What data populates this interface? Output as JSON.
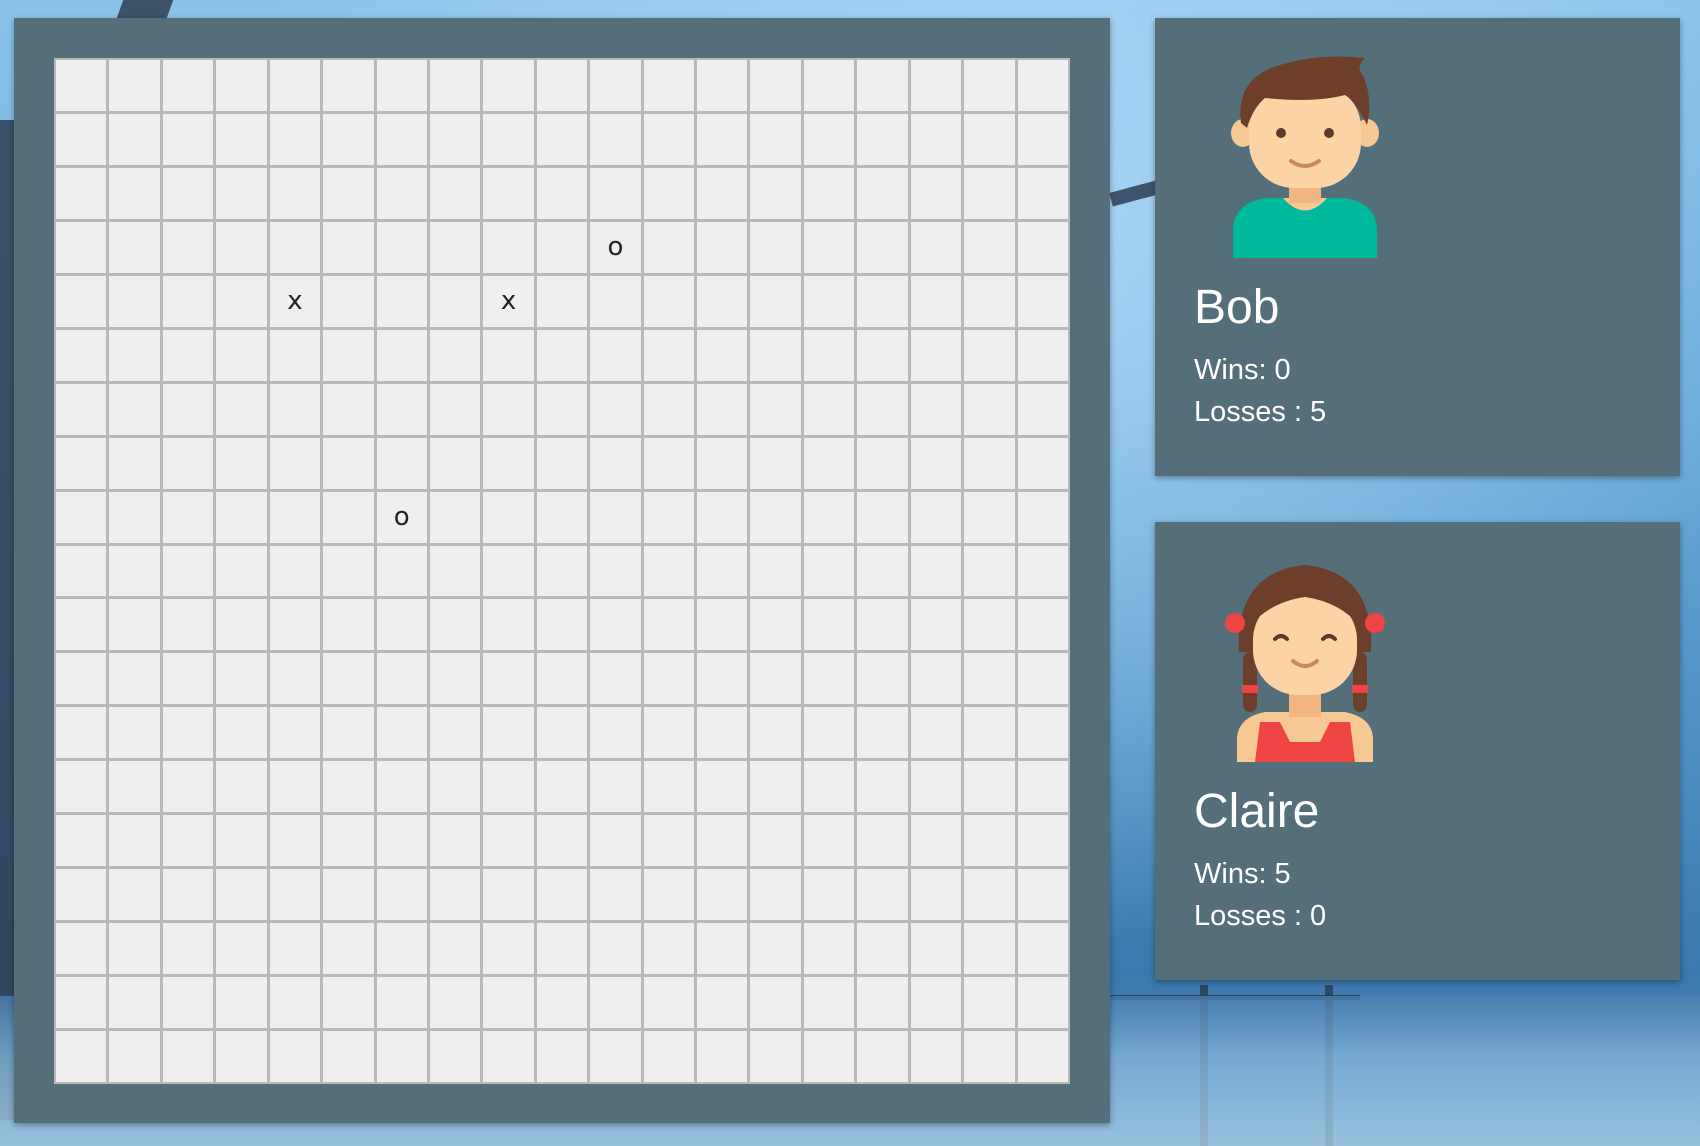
{
  "board": {
    "rows": 19,
    "cols": 19,
    "marks": [
      {
        "row": 3,
        "col": 10,
        "symbol": "o"
      },
      {
        "row": 4,
        "col": 4,
        "symbol": "x"
      },
      {
        "row": 4,
        "col": 8,
        "symbol": "x"
      },
      {
        "row": 8,
        "col": 6,
        "symbol": "o"
      }
    ]
  },
  "players": [
    {
      "name": "Bob",
      "avatar_icon": "boy-avatar-icon",
      "wins_text": "Wins: 0",
      "losses_text": "Losses : 5",
      "wins": 0,
      "losses": 5
    },
    {
      "name": "Claire",
      "avatar_icon": "girl-avatar-icon",
      "wins_text": "Wins: 5",
      "losses_text": "Losses : 0",
      "wins": 5,
      "losses": 0
    }
  ],
  "colors": {
    "panel": "#546e7a",
    "cell": "#efefef",
    "grid_line": "#b9b9b9"
  }
}
